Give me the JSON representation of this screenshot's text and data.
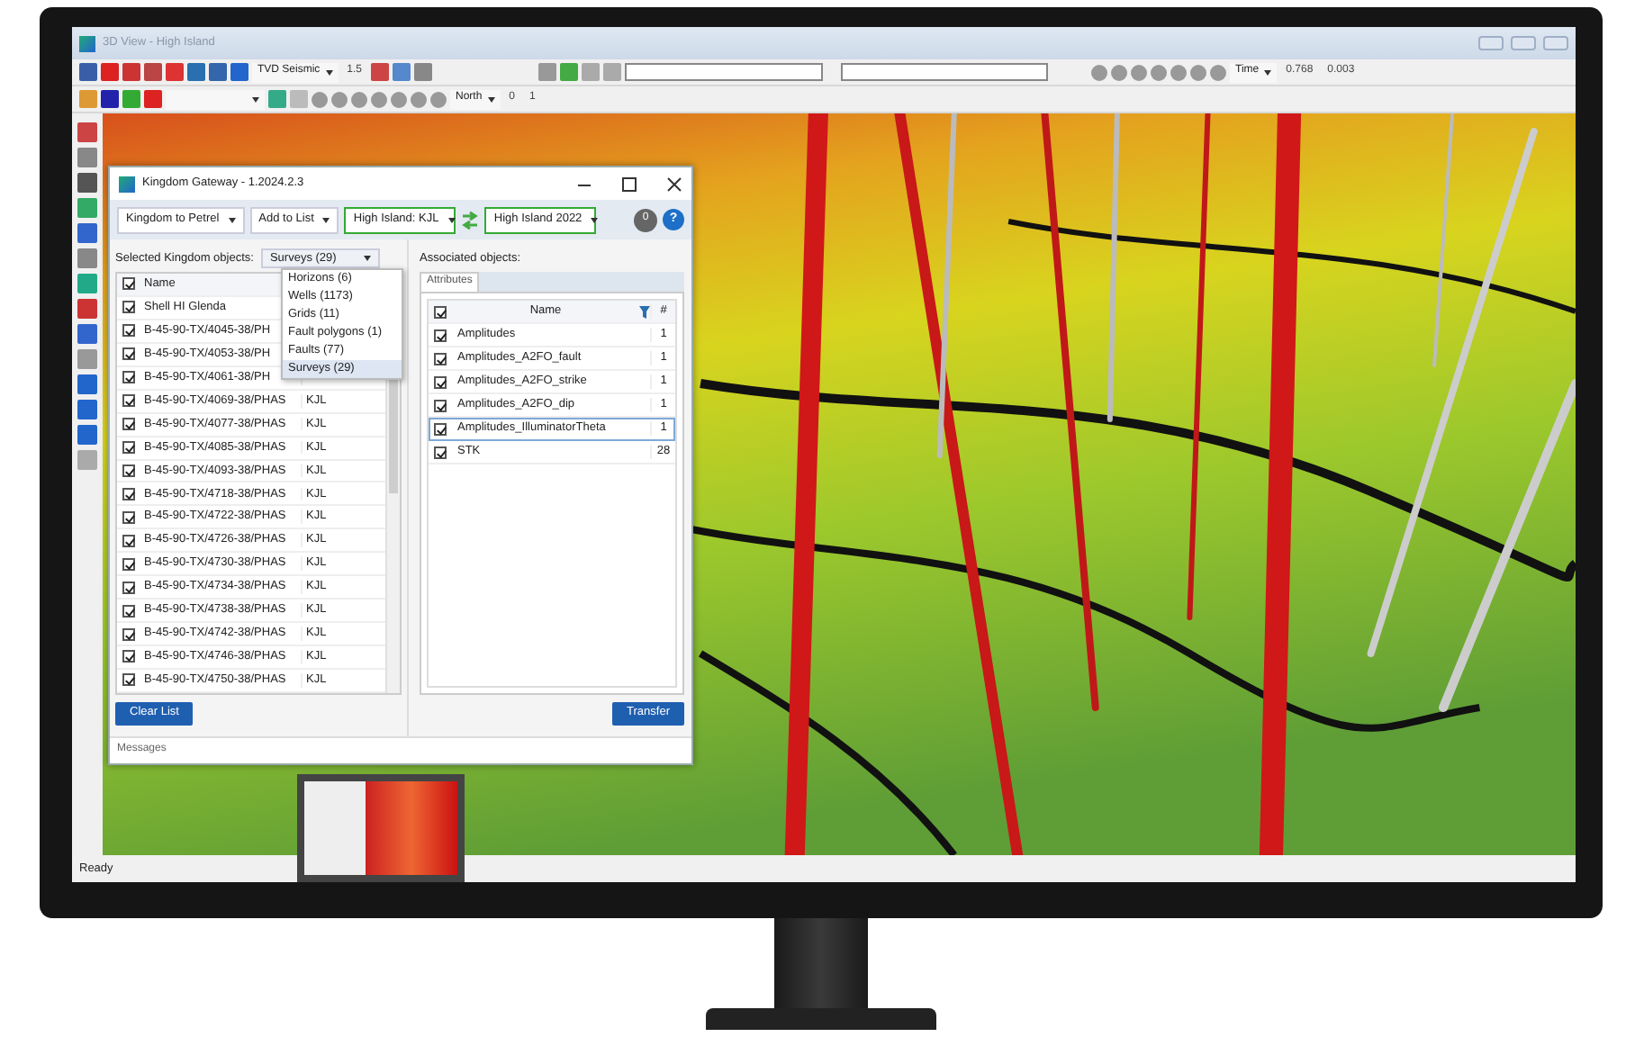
{
  "window": {
    "title": "3D View - High Island"
  },
  "toolbar": {
    "domain": "TVD Seismic",
    "scale": "1.5",
    "time_domain": "Time",
    "time_start": "0.768",
    "time_step": "0.003",
    "direction": "North",
    "start": "0",
    "end": "1"
  },
  "dialog": {
    "title": "Kingdom Gateway  -  1.2024.2.3",
    "direction": "Kingdom to  Petrel",
    "action": "Add to List",
    "source_project": "High Island: KJL",
    "target_project": "High Island 2022",
    "badge": "0",
    "help": "?",
    "selected_label": "Selected Kingdom objects:",
    "object_type": "Surveys (29)",
    "object_types": [
      {
        "label": "Horizons (6)",
        "selected": false
      },
      {
        "label": "Wells (1173)",
        "selected": false
      },
      {
        "label": "Grids (11)",
        "selected": false
      },
      {
        "label": "Fault polygons (1)",
        "selected": false
      },
      {
        "label": "Faults (77)",
        "selected": false
      },
      {
        "label": "Surveys (29)",
        "selected": true
      }
    ],
    "left_table": {
      "all_checked": true,
      "columns": [
        "Name"
      ],
      "rows": [
        {
          "name": "Shell HI Glenda",
          "checked": true
        },
        {
          "name": "B-45-90-TX/4045-38/PH",
          "checked": true
        },
        {
          "name": "B-45-90-TX/4053-38/PH",
          "checked": true
        },
        {
          "name": "B-45-90-TX/4061-38/PH",
          "checked": true
        },
        {
          "name": "B-45-90-TX/4069-38/PHAS",
          "project": "KJL",
          "checked": true
        },
        {
          "name": "B-45-90-TX/4077-38/PHAS",
          "project": "KJL",
          "checked": true
        },
        {
          "name": "B-45-90-TX/4085-38/PHAS",
          "project": "KJL",
          "checked": true
        },
        {
          "name": "B-45-90-TX/4093-38/PHAS",
          "project": "KJL",
          "checked": true
        },
        {
          "name": "B-45-90-TX/4718-38/PHAS",
          "project": "KJL",
          "checked": true
        },
        {
          "name": "B-45-90-TX/4722-38/PHAS",
          "project": "KJL",
          "checked": true
        },
        {
          "name": "B-45-90-TX/4726-38/PHAS",
          "project": "KJL",
          "checked": true
        },
        {
          "name": "B-45-90-TX/4730-38/PHAS",
          "project": "KJL",
          "checked": true
        },
        {
          "name": "B-45-90-TX/4734-38/PHAS",
          "project": "KJL",
          "checked": true
        },
        {
          "name": "B-45-90-TX/4738-38/PHAS",
          "project": "KJL",
          "checked": true
        },
        {
          "name": "B-45-90-TX/4742-38/PHAS",
          "project": "KJL",
          "checked": true
        },
        {
          "name": "B-45-90-TX/4746-38/PHAS",
          "project": "KJL",
          "checked": true
        },
        {
          "name": "B-45-90-TX/4750-38/PHAS",
          "project": "KJL",
          "checked": true
        }
      ]
    },
    "clear_button": "Clear List",
    "associated_label": "Associated objects:",
    "tabs": [
      {
        "label": "Attributes",
        "selected": true
      }
    ],
    "right_table": {
      "all_checked": true,
      "columns": [
        "Name",
        "#"
      ],
      "rows": [
        {
          "name": "Amplitudes",
          "count": "1",
          "checked": true,
          "selected": false
        },
        {
          "name": "Amplitudes_A2FO_fault",
          "count": "1",
          "checked": true,
          "selected": false
        },
        {
          "name": "Amplitudes_A2FO_strike",
          "count": "1",
          "checked": true,
          "selected": false
        },
        {
          "name": "Amplitudes_A2FO_dip",
          "count": "1",
          "checked": true,
          "selected": false
        },
        {
          "name": "Amplitudes_IlluminatorTheta",
          "count": "1",
          "checked": true,
          "selected": true
        },
        {
          "name": "STK",
          "count": "28",
          "checked": true,
          "selected": false
        }
      ]
    },
    "transfer_button": "Transfer",
    "messages_tab": "Messages"
  },
  "status_bar": {
    "text": "Ready"
  }
}
